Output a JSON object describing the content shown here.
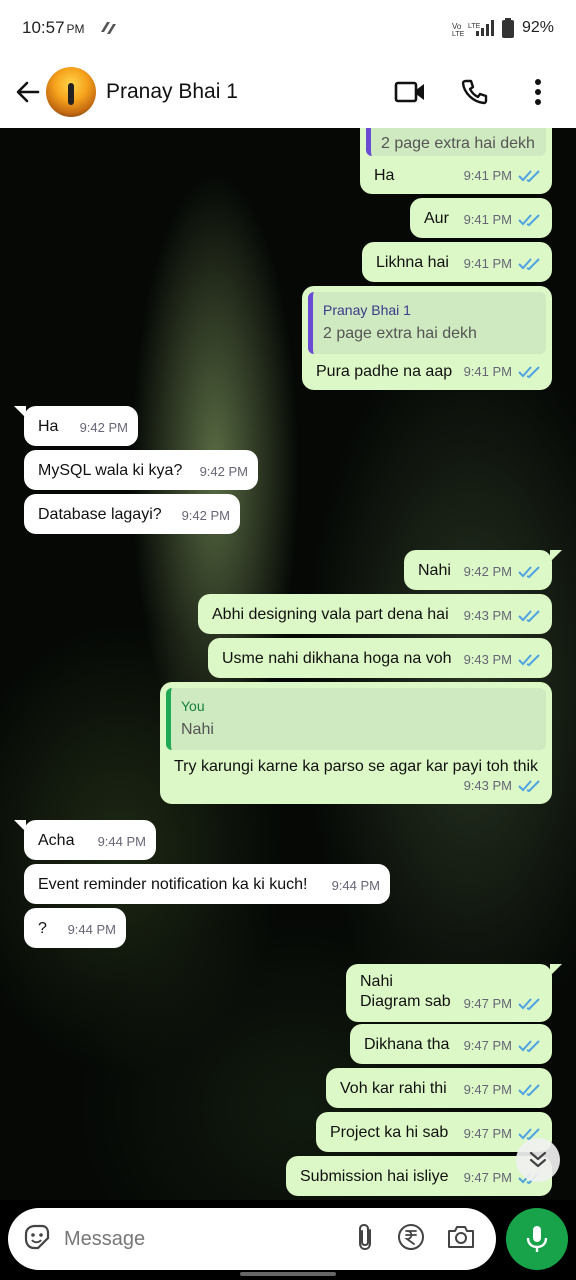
{
  "status_bar": {
    "time": "10:57",
    "ampm": "PM",
    "battery": "92%"
  },
  "header": {
    "contact_name": "Pranay Bhai 1"
  },
  "messages": [
    {
      "dir": "out",
      "text": "Ha",
      "time": "9:41 PM",
      "quote_text": "2 page extra hai dekh"
    },
    {
      "dir": "out",
      "text": "Aur",
      "time": "9:41 PM"
    },
    {
      "dir": "out",
      "text": "Likhna hai",
      "time": "9:41 PM"
    },
    {
      "dir": "out",
      "text": "Pura padhe na aap",
      "time": "9:41 PM",
      "quote_author": "Pranay Bhai 1",
      "quote_text": "2 page extra hai dekh"
    },
    {
      "dir": "in",
      "text": "Ha",
      "time": "9:42 PM"
    },
    {
      "dir": "in",
      "text": "MySQL wala ki kya?",
      "time": "9:42 PM"
    },
    {
      "dir": "in",
      "text": "Database lagayi?",
      "time": "9:42 PM"
    },
    {
      "dir": "out",
      "text": "Nahi",
      "time": "9:42 PM"
    },
    {
      "dir": "out",
      "text": "Abhi designing vala part dena hai",
      "time": "9:43 PM"
    },
    {
      "dir": "out",
      "text": "Usme nahi dikhana hoga na voh",
      "time": "9:43 PM"
    },
    {
      "dir": "out",
      "text": "Try karungi karne ka parso se agar kar payi toh thik",
      "time": "9:43 PM",
      "quote_author": "You",
      "quote_text": "Nahi"
    },
    {
      "dir": "in",
      "text": "Acha",
      "time": "9:44 PM"
    },
    {
      "dir": "in",
      "text": "Event reminder notification ka ki kuch!",
      "time": "9:44 PM"
    },
    {
      "dir": "in",
      "text": "?",
      "time": "9:44 PM"
    },
    {
      "dir": "out",
      "text": "Nahi",
      "text2": "Diagram sab",
      "time": "9:47 PM"
    },
    {
      "dir": "out",
      "text": "Dikhana tha",
      "time": "9:47 PM"
    },
    {
      "dir": "out",
      "text": "Voh kar rahi thi",
      "time": "9:47 PM"
    },
    {
      "dir": "out",
      "text": "Project ka hi sab",
      "time": "9:47 PM"
    },
    {
      "dir": "out",
      "text": "Submission hai isliye",
      "time": "9:47 PM"
    }
  ],
  "composer": {
    "placeholder": "Message"
  },
  "colors": {
    "outgoing_bubble": "#dcf8c6",
    "incoming_bubble": "#ffffff",
    "read_ticks": "#4fa3e0",
    "send_button": "#18a34a"
  }
}
